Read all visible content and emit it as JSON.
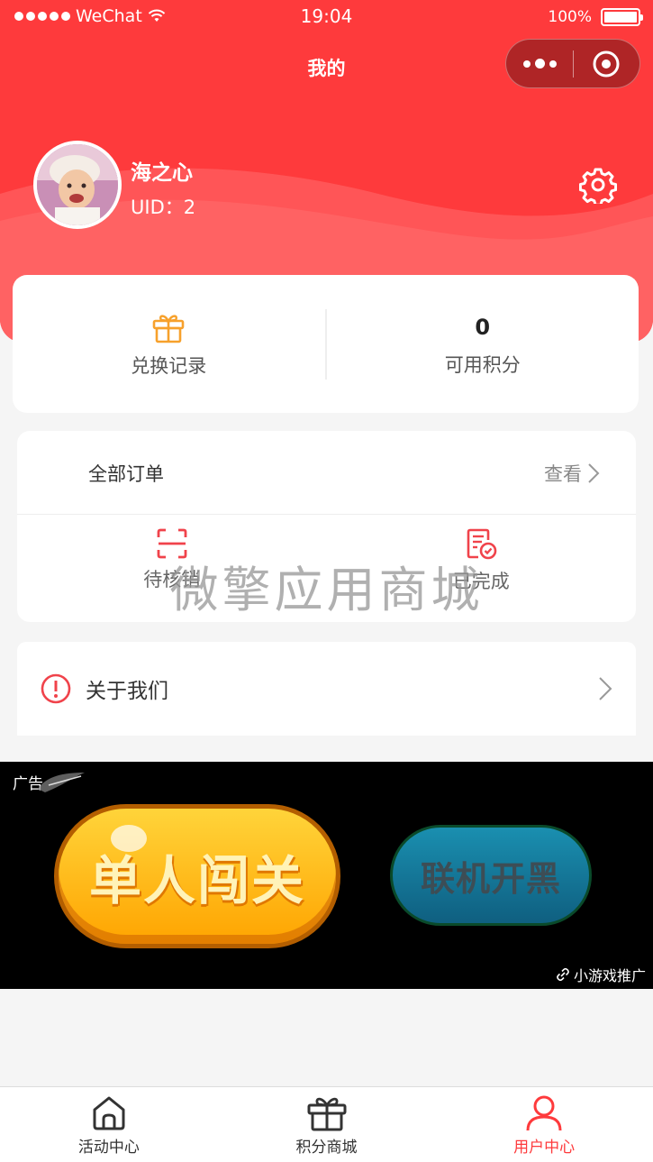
{
  "status_bar": {
    "carrier": "WeChat",
    "time": "19:04",
    "battery": "100%",
    "battery_level": 1.0
  },
  "nav": {
    "title": "我的"
  },
  "user": {
    "name": "海之心",
    "uid": "UID：2"
  },
  "stats": {
    "exchange_label": "兑换记录",
    "points_value": "0",
    "points_label": "可用积分"
  },
  "orders": {
    "title": "全部订单",
    "view_label": "查看",
    "items": [
      {
        "label": "待核销",
        "icon": "scan-icon"
      },
      {
        "label": "已完成",
        "icon": "completed-doc-icon"
      }
    ]
  },
  "watermark": "微擎应用商城",
  "about": {
    "label": "关于我们",
    "icon": "info-icon"
  },
  "ad": {
    "tag": "广告",
    "btn_single": "单人闯关",
    "btn_multi": "联机开黑",
    "source": "小游戏推广"
  },
  "tabbar": {
    "items": [
      {
        "label": "活动中心",
        "icon": "home-icon"
      },
      {
        "label": "积分商城",
        "icon": "gift-icon"
      },
      {
        "label": "用户中心",
        "icon": "user-icon"
      }
    ],
    "active_index": 2
  },
  "colors": {
    "brand_red": "#fe3a3c",
    "gift_orange": "#f7a12c",
    "order_icon_red": "#f0434b"
  }
}
